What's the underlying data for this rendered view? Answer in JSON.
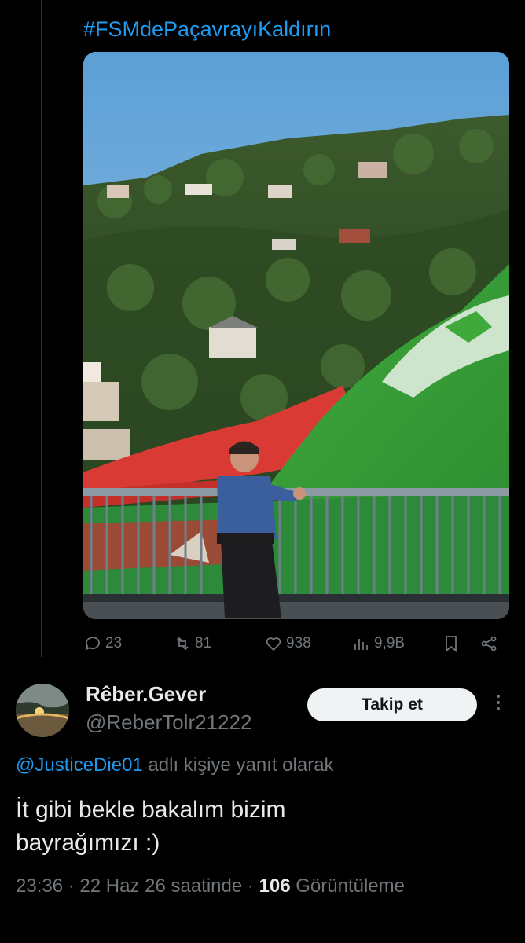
{
  "parent_tweet": {
    "hashtag": "#FSMdePaçavrayıKaldırın",
    "media": {
      "icon": "photo-image",
      "scene": "police officer on bridge railing, large green and red flag over wooded hillside"
    },
    "actions": {
      "replies": "23",
      "retweets": "81",
      "likes": "938",
      "views": "9,9B"
    }
  },
  "reply": {
    "display_name": "Rêber.Gever",
    "handle": "@ReberTolr21222",
    "follow_label": "Takip et",
    "reply_to_mention": "@JusticeDie01",
    "reply_to_suffix": " adlı kişiye yanıt olarak",
    "text_line1": "İt gibi bekle bakalım bizim",
    "text_line2": "bayrağımızı :)",
    "time": "23:36",
    "date": "22 Haz 26 saatinde",
    "views_count": "106",
    "views_label": "Görüntüleme"
  },
  "colors": {
    "background": "#000000",
    "accent": "#1d9bf0",
    "text_primary": "#e7e9ea",
    "text_secondary": "#71767b",
    "button_bg": "#eff3f4"
  }
}
